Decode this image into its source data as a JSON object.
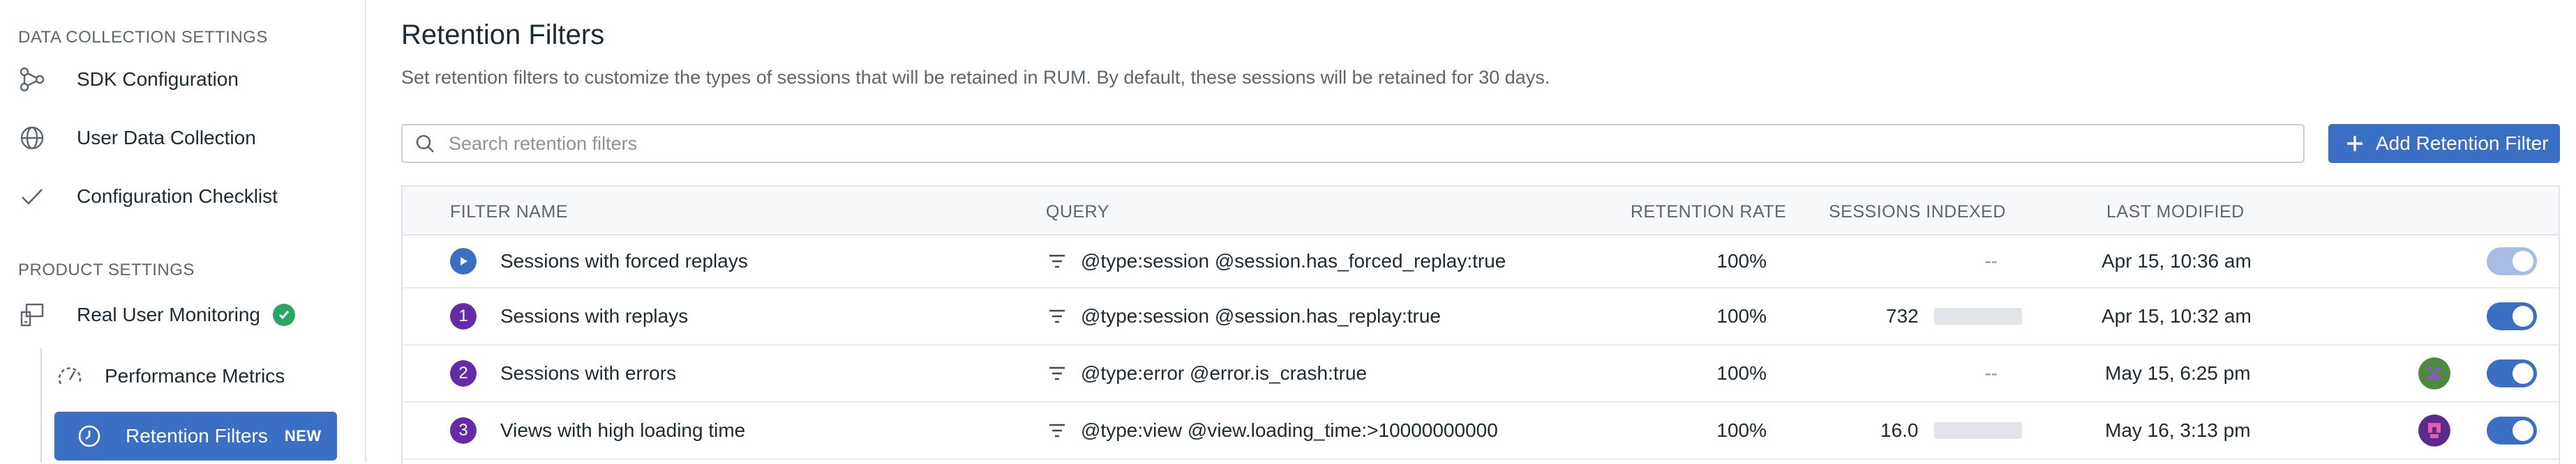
{
  "sidebar": {
    "section1": "DATA COLLECTION SETTINGS",
    "items": [
      {
        "label": "SDK Configuration",
        "icon": "sdk-nodes-icon"
      },
      {
        "label": "User Data Collection",
        "icon": "globe-icon"
      },
      {
        "label": "Configuration Checklist",
        "icon": "checkmark-icon"
      }
    ],
    "section2": "PRODUCT SETTINGS",
    "product": {
      "label": "Real User Monitoring",
      "icon": "rum-icon",
      "status_icon": "check-circle-icon"
    },
    "subitems": [
      {
        "label": "Performance Metrics",
        "icon": "gauge-icon"
      }
    ],
    "active": {
      "label": "Retention Filters",
      "badge": "NEW",
      "icon": "clock-icon"
    }
  },
  "header": {
    "title": "Retention Filters",
    "description": "Set retention filters to customize the types of sessions that will be retained in RUM. By default, these sessions will be retained for 30 days."
  },
  "search": {
    "placeholder": "Search retention filters",
    "value": "",
    "icon": "search-icon"
  },
  "add_button": {
    "label": "Add Retention Filter",
    "icon": "plus-icon"
  },
  "table": {
    "columns": [
      "FILTER NAME",
      "QUERY",
      "RETENTION RATE",
      "SESSIONS INDEXED",
      "LAST MODIFIED"
    ],
    "rows": [
      {
        "marker": "play",
        "name": "Sessions with forced replays",
        "query": "@type:session @session.has_forced_replay:true",
        "rate": "100%",
        "indexed": "--",
        "indexed_bar": false,
        "modified": "Apr 15, 10:36 am",
        "avatar": null,
        "enabled": true,
        "toggle_disabled": true
      },
      {
        "marker": "1",
        "name": "Sessions with replays",
        "query": "@type:session @session.has_replay:true",
        "rate": "100%",
        "indexed": "732",
        "indexed_bar": true,
        "modified": "Apr 15, 10:32 am",
        "avatar": null,
        "enabled": true,
        "toggle_disabled": false
      },
      {
        "marker": "2",
        "name": "Sessions with errors",
        "query": "@type:error @error.is_crash:true",
        "rate": "100%",
        "indexed": "--",
        "indexed_bar": false,
        "modified": "May 15, 6:25 pm",
        "avatar": "green",
        "enabled": true,
        "toggle_disabled": false
      },
      {
        "marker": "3",
        "name": "Views with high loading time",
        "query": "@type:view @view.loading_time:>10000000000",
        "rate": "100%",
        "indexed": "16.0",
        "indexed_bar": true,
        "modified": "May 16, 3:13 pm",
        "avatar": "purple",
        "enabled": true,
        "toggle_disabled": false
      }
    ]
  },
  "colors": {
    "accent": "#3a6fc4",
    "number_badge": "#632ca6",
    "success": "#2ba464"
  }
}
